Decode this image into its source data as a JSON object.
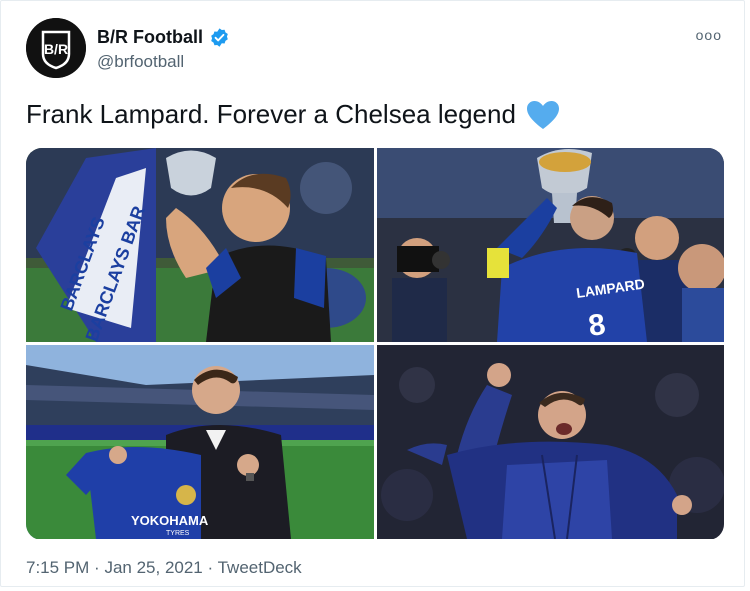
{
  "tweet": {
    "author_name": "B/R Football",
    "handle": "@brfootball",
    "avatar_text": "B/R",
    "text": "Frank Lampard. Forever a Chelsea legend",
    "emoji": "blue-heart",
    "more_label": "ooo",
    "time": "7:15 PM",
    "separator": "·",
    "date": "Jan 25, 2021",
    "source": "TweetDeck"
  },
  "photos": {
    "photo1": {
      "banner_text": "BARCLAYS",
      "banner_text2": "BARCLAYS BAR"
    },
    "photo2": {
      "shirt_name": "LAMPARD",
      "shirt_number": "8"
    },
    "photo3": {
      "sponsor": "YOKOHAMA",
      "sponsor_sub": "TYRES"
    },
    "photo4": {}
  },
  "colors": {
    "accent": "#1d9bf0",
    "chelsea_blue": "#1b3fa0",
    "muted": "#536471"
  }
}
